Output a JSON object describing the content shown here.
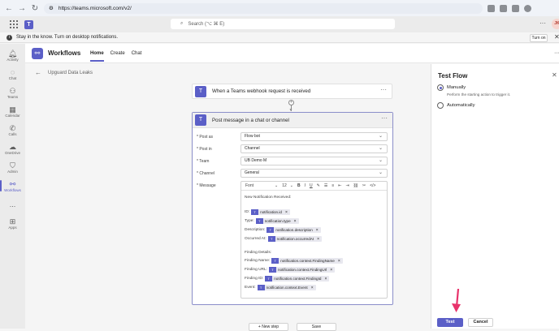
{
  "browser": {
    "url": "https://teams.microsoft.com/v2/"
  },
  "teams": {
    "search_placeholder": "Search (⌥ ⌘ E)",
    "avatar_initials": "JK"
  },
  "notification": {
    "text": "Stay in the know. Turn on desktop notifications.",
    "turn_on_label": "Turn on"
  },
  "rail": [
    {
      "label": "Activity",
      "icon": "bell-icon"
    },
    {
      "label": "Chat",
      "icon": "chat-icon"
    },
    {
      "label": "Teams",
      "icon": "teams-icon"
    },
    {
      "label": "Calendar",
      "icon": "calendar-icon"
    },
    {
      "label": "Calls",
      "icon": "phone-icon"
    },
    {
      "label": "OneDrive",
      "icon": "cloud-icon"
    },
    {
      "label": "Admin",
      "icon": "shield-icon"
    },
    {
      "label": "Workflows",
      "icon": "workflows-icon"
    },
    {
      "label": "...",
      "icon": "more-icon"
    },
    {
      "label": "Apps",
      "icon": "apps-icon"
    }
  ],
  "app": {
    "title": "Workflows",
    "tabs": [
      "Home",
      "Create",
      "Chat"
    ],
    "active_tab": "Home"
  },
  "flow": {
    "breadcrumb": "Upguard Data Leaks",
    "trigger_title": "When a Teams webhook request is received",
    "action_title": "Post message in a chat or channel",
    "fields": [
      {
        "label": "* Post as",
        "value": "Flow bot"
      },
      {
        "label": "* Post in",
        "value": "Channel"
      },
      {
        "label": "* Team",
        "value": "UB Demo M"
      },
      {
        "label": "* Channel",
        "value": "General"
      }
    ],
    "message_label": "* Message",
    "toolbar": {
      "font": "Font",
      "size": "12"
    },
    "message": {
      "heading": "New Notification Received:",
      "lines": [
        {
          "label": "ID:",
          "token": "notification.id"
        },
        {
          "label": "Type:",
          "token": "notification.type"
        },
        {
          "label": "Description:",
          "token": "notification.description"
        },
        {
          "label": "Occurred At:",
          "token": "notification.occurredAt"
        }
      ],
      "finding_heading": "Finding Details:",
      "finding_lines": [
        {
          "label": "Finding Name:",
          "token": "notification.context.FindingName"
        },
        {
          "label": "Finding URL:",
          "token": "notification.context.FindingUrl"
        },
        {
          "label": "Finding ID:",
          "token": "notification.context.FindingId"
        },
        {
          "label": "Event:",
          "token": "notification.context.Event"
        }
      ]
    },
    "new_step_label": "+ New step",
    "save_label": "Save"
  },
  "panel": {
    "title": "Test Flow",
    "manual_label": "Manually",
    "manual_desc": "Perform the starting action to trigger it.",
    "auto_label": "Automatically",
    "test_label": "Test",
    "cancel_label": "Cancel"
  },
  "colors": {
    "brand": "#5b5fc7",
    "annotation_arrow": "#e8336b"
  }
}
